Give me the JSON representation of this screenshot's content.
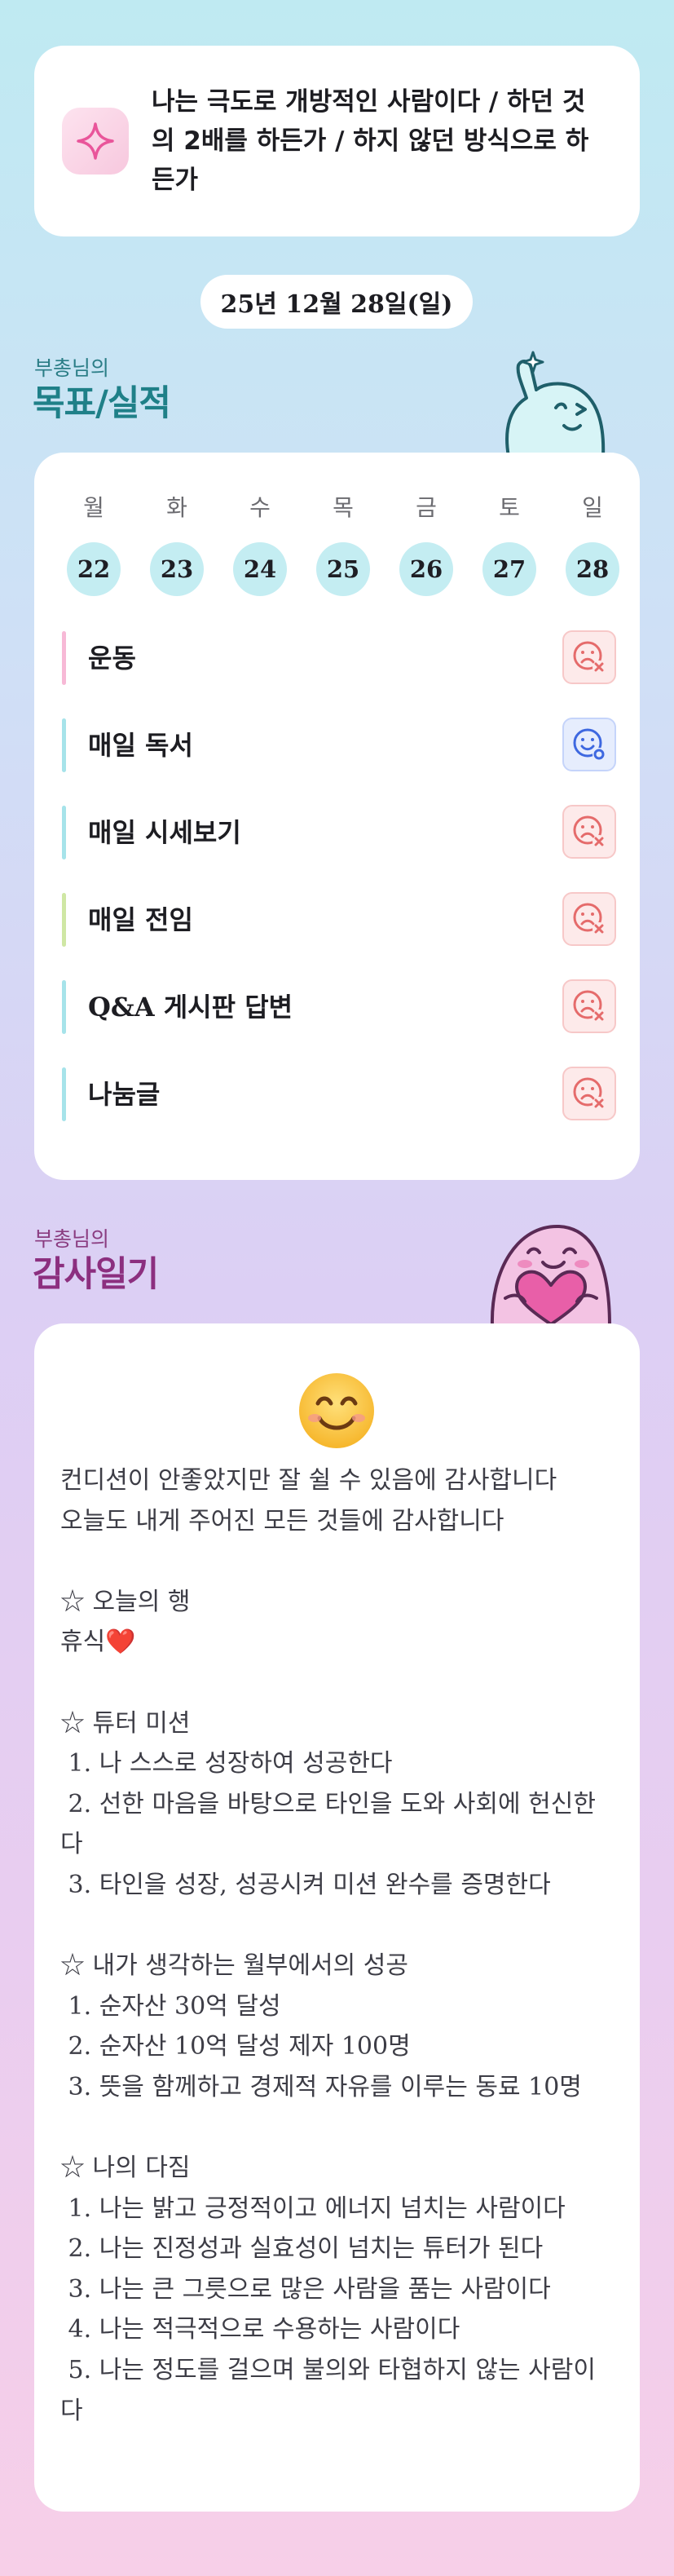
{
  "motto": {
    "icon": "sparkle-icon",
    "text": "나는 극도로 개방적인 사람이다 / 하던 것의 2배를 하든가 / 하지 않던 방식으로 하든가"
  },
  "date": "25년 12월 28일(일)",
  "goals_section": {
    "subtitle": "부총님의",
    "title": "목표/실적",
    "mascot_icon": "waving-mascot-icon"
  },
  "week": {
    "days": [
      {
        "name": "월",
        "num": "22"
      },
      {
        "name": "화",
        "num": "23"
      },
      {
        "name": "수",
        "num": "24"
      },
      {
        "name": "목",
        "num": "25"
      },
      {
        "name": "금",
        "num": "26"
      },
      {
        "name": "토",
        "num": "27"
      },
      {
        "name": "일",
        "num": "28"
      }
    ]
  },
  "goals": [
    {
      "label": "운동",
      "bar_color": "#f7b9d6",
      "status": "sad-x-face-icon"
    },
    {
      "label": "매일 독서",
      "bar_color": "#a6e3ea",
      "status": "happy-face-icon"
    },
    {
      "label": "매일 시세보기",
      "bar_color": "#a6e3ea",
      "status": "sad-x-face-icon"
    },
    {
      "label": "매일 전임",
      "bar_color": "#cfe7a4",
      "status": "sad-x-face-icon"
    },
    {
      "label": "Q&A 게시판 답변",
      "bar_color": "#a6e3ea",
      "status": "sad-x-face-icon"
    },
    {
      "label": "나눔글",
      "bar_color": "#a6e3ea",
      "status": "sad-x-face-icon"
    }
  ],
  "gratitude_section": {
    "subtitle": "부총님의",
    "title": "감사일기",
    "mascot_icon": "heart-hugging-mascot-icon"
  },
  "gratitude": {
    "emoji": "smiling-face-icon",
    "text": "컨디션이 안좋았지만 잘 쉴 수 있음에 감사합니다\n오늘도 내게 주어진 모든 것들에 감사합니다\n\n☆ 오늘의 행\n휴식❤️\n\n☆ 튜터 미션\n 1. 나 스스로 성장하여 성공한다\n 2. 선한 마음을 바탕으로 타인을 도와 사회에 헌신한다\n 3. 타인을 성장, 성공시켜 미션 완수를 증명한다\n\n☆ 내가 생각하는 월부에서의 성공\n 1. 순자산 30억 달성\n 2. 순자산 10억 달성 제자 100명\n 3. 뜻을 함께하고 경제적 자유를 이루는 동료 10명\n\n☆ 나의 다짐\n 1. 나는 밝고 긍정적이고 에너지 넘치는 사람이다\n 2. 나는 진정성과 실효성이 넘치는 튜터가 된다\n 3. 나는 큰 그릇으로 많은 사람을 품는 사람이다\n 4. 나는 적극적으로 수용하는 사람이다\n 5. 나는 정도를 걸으며 불의와 타협하지 않는 사람이다"
  }
}
